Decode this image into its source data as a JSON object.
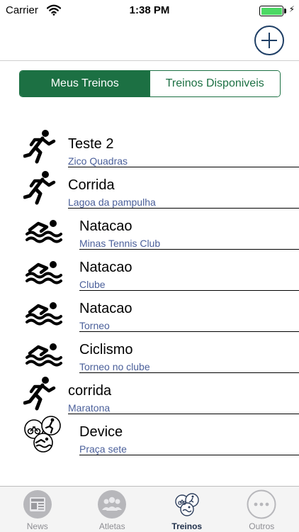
{
  "status_bar": {
    "carrier": "Carrier",
    "time": "1:38 PM",
    "battery_level": 1.0,
    "charging_icon": "bolt-icon",
    "battery_color": "#4cd964"
  },
  "nav_bar": {
    "add_icon": "plus-circle-icon"
  },
  "segmented_control": {
    "segments": [
      "Meus Treinos",
      "Treinos Disponiveis"
    ],
    "selected_index": 0,
    "accent_color": "#1c7043"
  },
  "workouts": [
    {
      "title": "Teste 2",
      "subtitle": "Zico Quadras",
      "icon": "running-icon"
    },
    {
      "title": "Corrida",
      "subtitle": "Lagoa da pampulha",
      "icon": "running-icon"
    },
    {
      "title": "Natacao",
      "subtitle": "Minas Tennis Club",
      "icon": "swimming-icon"
    },
    {
      "title": "Natacao",
      "subtitle": "Clube",
      "icon": "swimming-icon"
    },
    {
      "title": "Natacao",
      "subtitle": "Torneo",
      "icon": "swimming-icon"
    },
    {
      "title": "Ciclismo",
      "subtitle": "Torneo no clube",
      "icon": "swimming-icon"
    },
    {
      "title": "corrida",
      "subtitle": "Maratona",
      "icon": "running-icon"
    },
    {
      "title": "Device",
      "subtitle": "Praça sete",
      "icon": "triathlon-icon"
    }
  ],
  "subtitle_color": "#4a5f9a",
  "tab_bar": {
    "tabs": [
      {
        "label": "News",
        "icon": "newspaper-icon"
      },
      {
        "label": "Atletas",
        "icon": "people-icon"
      },
      {
        "label": "Treinos",
        "icon": "triathlon-icon"
      },
      {
        "label": "Outros",
        "icon": "more-icon"
      }
    ],
    "selected_index": 2
  }
}
